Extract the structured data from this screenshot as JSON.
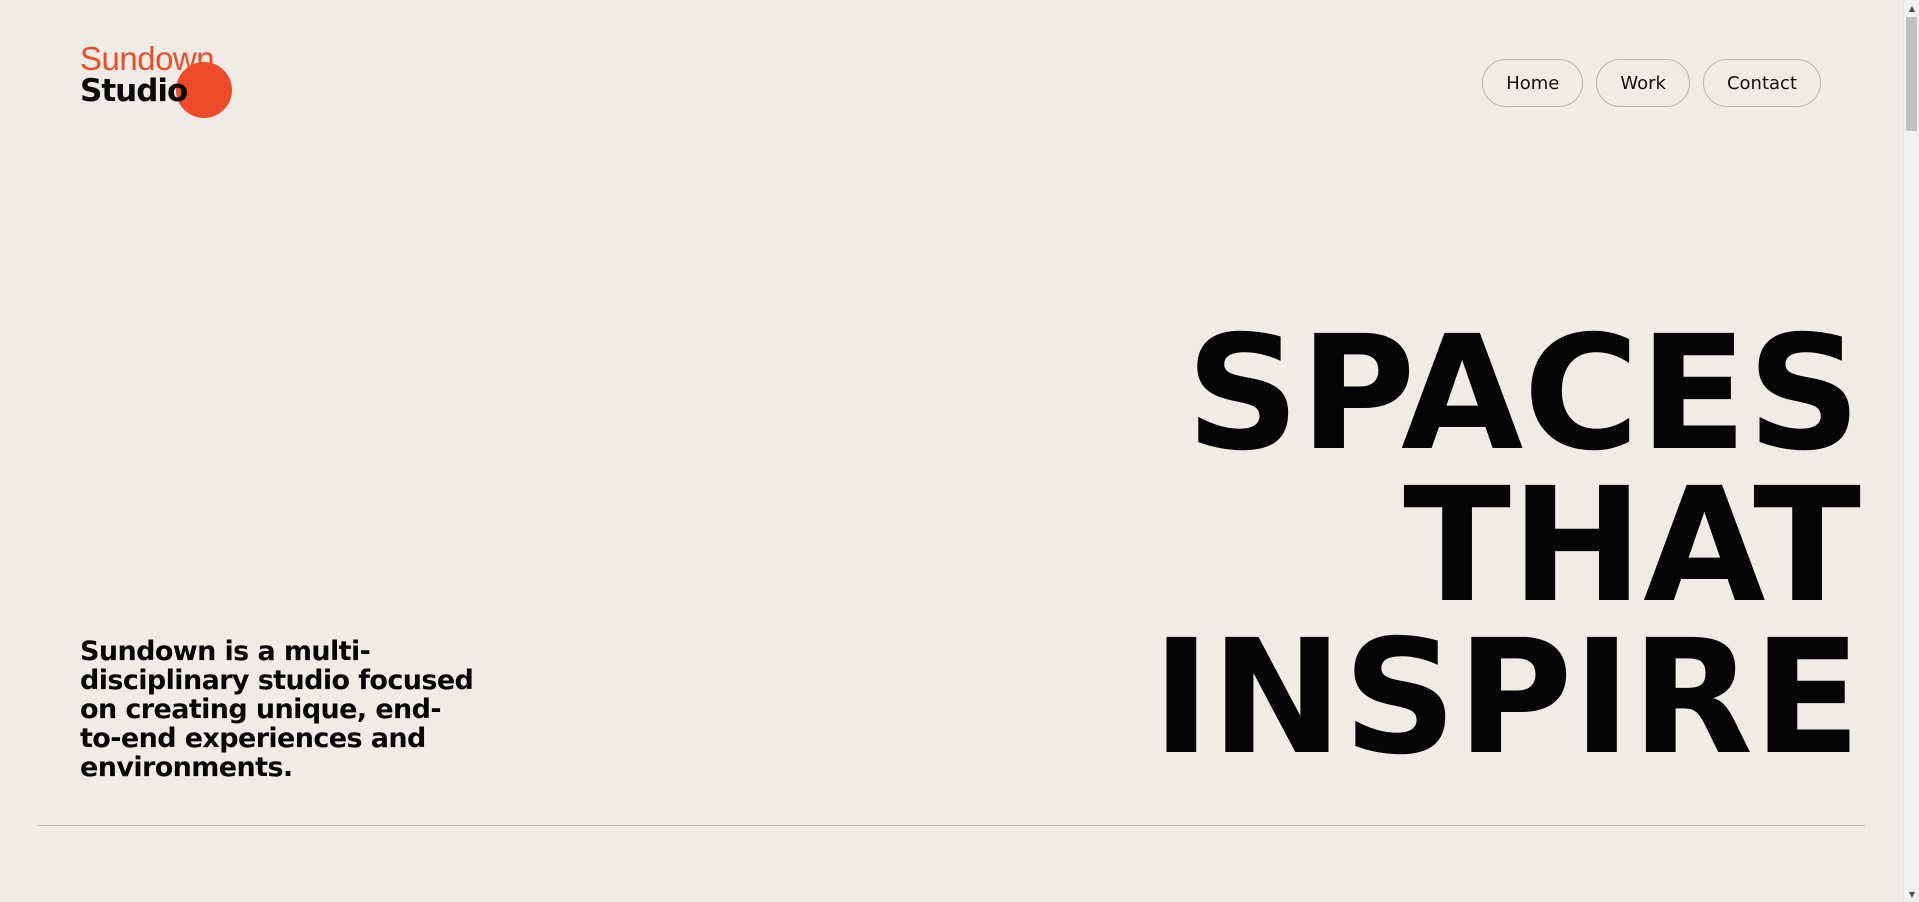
{
  "logo": {
    "line1": "Sundown",
    "line2": "Studio",
    "accent_color": "#ee4b2b"
  },
  "nav": {
    "items": [
      {
        "label": "Home"
      },
      {
        "label": "Work"
      },
      {
        "label": "Contact"
      }
    ]
  },
  "hero": {
    "lines": [
      "SPACES",
      "THAT",
      "INSPIRE"
    ]
  },
  "intro": {
    "text": "Sundown is a multi-disciplinary studio focused on creating unique, end-to-end experiences and environments."
  },
  "scrollbar": {
    "up_icon": "▲",
    "down_icon": "▼"
  },
  "colors": {
    "background": "#efebe5",
    "text": "#050505",
    "accent": "#ee4b2b"
  }
}
